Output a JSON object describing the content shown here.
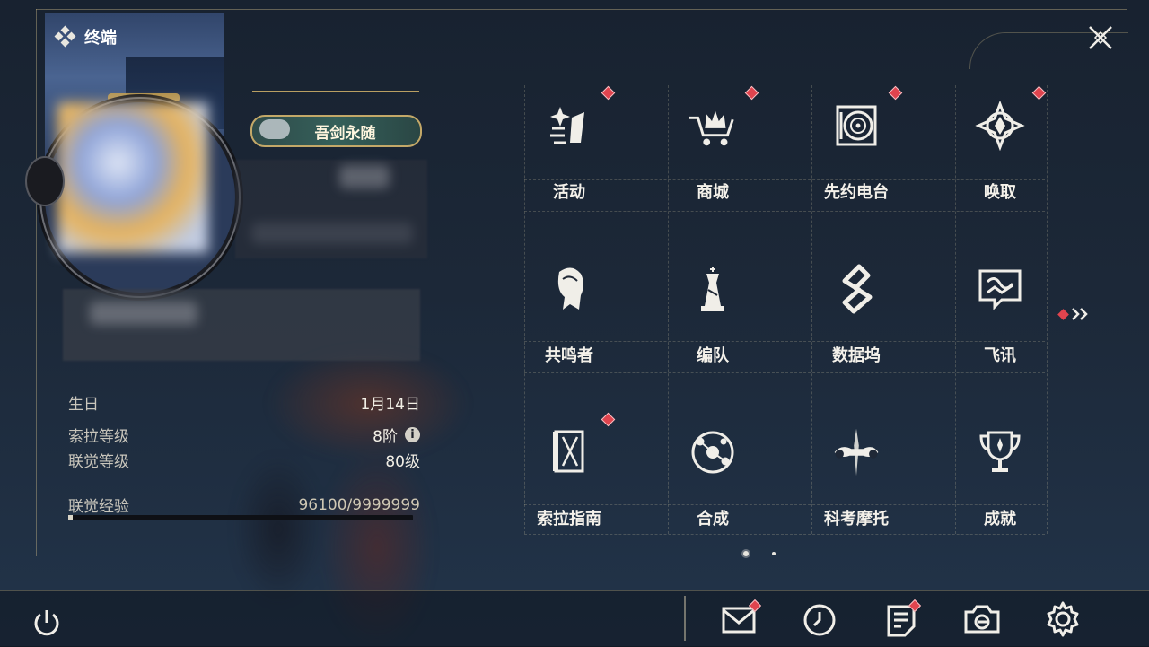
{
  "header": {
    "title": "终端",
    "icons": {
      "terminal": "diamond-cluster-icon",
      "close": "close-x-icon"
    }
  },
  "profile": {
    "title_badge": "吾剑永随",
    "info": {
      "birthday_label": "生日",
      "birthday_value": "1月14日",
      "sola_level_label": "索拉等级",
      "sola_level_value": "8阶",
      "union_level_label": "联觉等级",
      "union_level_value": "80级",
      "union_exp_label": "联觉经验",
      "union_exp_value": "96100/9999999",
      "union_exp_progress": 0.0096
    }
  },
  "menu": {
    "items": [
      {
        "label": "活动",
        "icon": "activity-icon",
        "badge": true
      },
      {
        "label": "商城",
        "icon": "shop-crown-cart-icon",
        "badge": true
      },
      {
        "label": "先约电台",
        "icon": "radio-disc-icon",
        "badge": true
      },
      {
        "label": "唤取",
        "icon": "gacha-compass-icon",
        "badge": true
      },
      {
        "label": "共鸣者",
        "icon": "resonator-head-icon",
        "badge": false
      },
      {
        "label": "编队",
        "icon": "team-chess-icon",
        "badge": false
      },
      {
        "label": "数据坞",
        "icon": "data-bank-icon",
        "badge": false
      },
      {
        "label": "飞讯",
        "icon": "message-bubble-icon",
        "badge": false
      },
      {
        "label": "索拉指南",
        "icon": "guide-book-icon",
        "badge": true
      },
      {
        "label": "合成",
        "icon": "synthesis-orbit-icon",
        "badge": false
      },
      {
        "label": "科考摩托",
        "icon": "motorbike-icon",
        "badge": false
      },
      {
        "label": "成就",
        "icon": "trophy-icon",
        "badge": false
      }
    ],
    "pager": {
      "current_page": 1,
      "total_pages": 2
    },
    "next_page_badge": true
  },
  "bottom_bar": {
    "power": "power-icon",
    "buttons": [
      {
        "icon": "mail-icon",
        "badge": true
      },
      {
        "icon": "clock-icon",
        "badge": false
      },
      {
        "icon": "notice-icon",
        "badge": true
      },
      {
        "icon": "camera-icon",
        "badge": false
      },
      {
        "icon": "settings-gear-icon",
        "badge": false
      }
    ]
  },
  "colors": {
    "badge_red": "#e0444e",
    "gold": "#c3a868",
    "text": "#f4f1ea"
  }
}
